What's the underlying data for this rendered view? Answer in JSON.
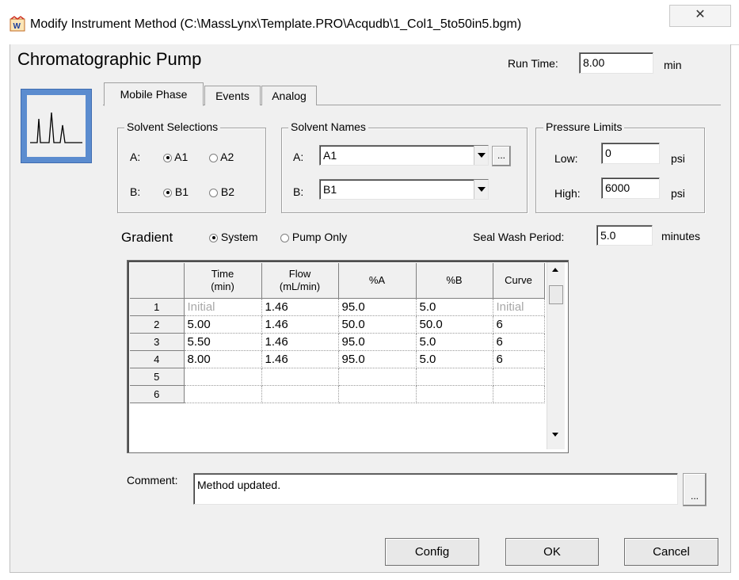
{
  "window": {
    "title": "Modify Instrument Method (C:\\MassLynx\\Template.PRO\\Acqudb\\1_Col1_5to50in5.bgm)",
    "close_glyph": "✕",
    "app_icon": "masslynx-app-icon"
  },
  "header": {
    "title": "Chromatographic Pump",
    "run_time_label": "Run Time:",
    "run_time_value": "8.00",
    "run_time_unit": "min",
    "module_icon": "chromatogram-icon"
  },
  "tabs": [
    {
      "label": "Mobile Phase",
      "active": true
    },
    {
      "label": "Events",
      "active": false
    },
    {
      "label": "Analog",
      "active": false
    }
  ],
  "solvent_selections": {
    "title": "Solvent Selections",
    "a_label": "A:",
    "b_label": "B:",
    "a_options": [
      "A1",
      "A2"
    ],
    "b_options": [
      "B1",
      "B2"
    ],
    "a_selected": "A1",
    "b_selected": "B1"
  },
  "solvent_names": {
    "title": "Solvent Names",
    "a_label": "A:",
    "b_label": "B:",
    "a_value": "A1",
    "b_value": "B1",
    "browse_label": "..."
  },
  "pressure_limits": {
    "title": "Pressure Limits",
    "low_label": "Low:",
    "low_value": "0",
    "high_label": "High:",
    "high_value": "6000",
    "unit": "psi"
  },
  "gradient": {
    "label": "Gradient",
    "options": [
      "System",
      "Pump Only"
    ],
    "selected": "System"
  },
  "seal_wash": {
    "label": "Seal Wash Period:",
    "value": "5.0",
    "unit": "minutes"
  },
  "table": {
    "headers": [
      {
        "line1": "Time",
        "line2": "(min)"
      },
      {
        "line1": "Flow",
        "line2": "(mL/min)"
      },
      {
        "line1": "%A",
        "line2": ""
      },
      {
        "line1": "%B",
        "line2": ""
      },
      {
        "line1": "Curve",
        "line2": ""
      }
    ],
    "rows": [
      {
        "num": "1",
        "cells": [
          "Initial",
          "1.46",
          "95.0",
          "5.0",
          "Initial"
        ]
      },
      {
        "num": "2",
        "cells": [
          "5.00",
          "1.46",
          "50.0",
          "50.0",
          "6"
        ]
      },
      {
        "num": "3",
        "cells": [
          "5.50",
          "1.46",
          "95.0",
          "5.0",
          "6"
        ]
      },
      {
        "num": "4",
        "cells": [
          "8.00",
          "1.46",
          "95.0",
          "5.0",
          "6"
        ]
      },
      {
        "num": "5",
        "cells": [
          "",
          "",
          "",
          "",
          ""
        ]
      },
      {
        "num": "6",
        "cells": [
          "",
          "",
          "",
          "",
          ""
        ]
      }
    ]
  },
  "comment": {
    "label": "Comment:",
    "value": "Method updated.",
    "browse_label": "..."
  },
  "buttons": {
    "config": "Config",
    "ok": "OK",
    "cancel": "Cancel"
  }
}
